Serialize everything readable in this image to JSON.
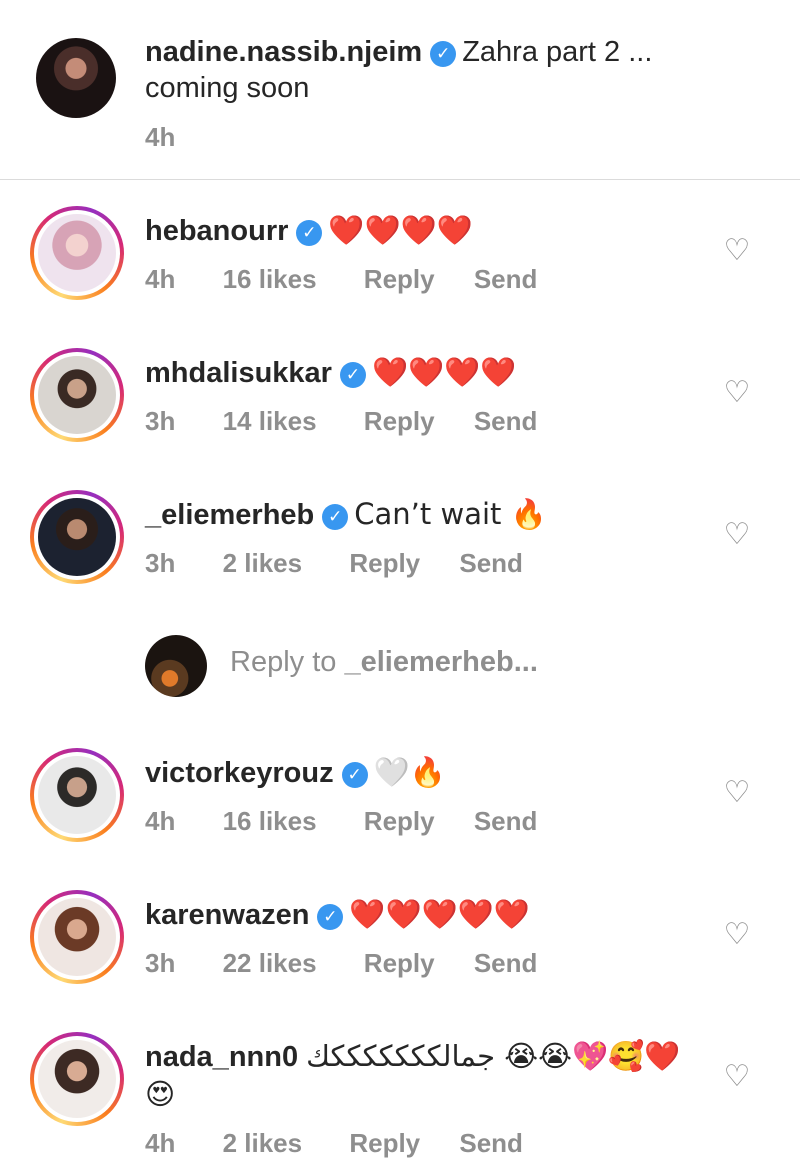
{
  "caption": {
    "username": "nadine.nassib.njeim",
    "text_line1": "Zahra part 2 ...",
    "text_line2": "coming soon",
    "time": "4h"
  },
  "comments": [
    {
      "username": "hebanourr",
      "text": "❤️❤️❤️❤️",
      "time": "4h",
      "likes": "16 likes",
      "reply": "Reply",
      "send": "Send"
    },
    {
      "username": "mhdalisukkar",
      "text": "❤️❤️❤️❤️",
      "time": "3h",
      "likes": "14 likes",
      "reply": "Reply",
      "send": "Send"
    },
    {
      "username": "_eliemerheb",
      "text": "Can’t wait 🔥",
      "time": "3h",
      "likes": "2 likes",
      "reply": "Reply",
      "send": "Send"
    },
    {
      "username": "victorkeyrouz",
      "text": "🤍🔥",
      "time": "4h",
      "likes": "16 likes",
      "reply": "Reply",
      "send": "Send"
    },
    {
      "username": "karenwazen",
      "text": "❤️❤️❤️❤️❤️",
      "time": "3h",
      "likes": "22 likes",
      "reply": "Reply",
      "send": "Send"
    },
    {
      "username": "nada_nnn0",
      "text": "جمالكككككككك 😭😭💖🥰❤️",
      "text_line2": "😍",
      "time": "4h",
      "likes": "2 likes",
      "reply": "Reply",
      "send": "Send"
    }
  ],
  "reply_box": {
    "prefix": "Reply to ",
    "target": "_eliemerheb..."
  },
  "icons": {
    "verified": "verified-badge-icon",
    "like": "heart-outline-icon"
  },
  "colors": {
    "verified": "#3897f0",
    "muted": "#8e8e8e",
    "text": "#262626"
  }
}
